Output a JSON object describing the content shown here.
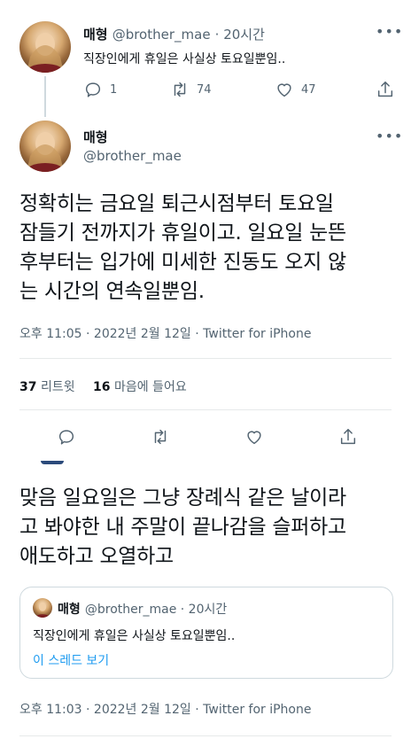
{
  "reply_tweet": {
    "name": "매형",
    "handle": "@brother_mae",
    "time": "· 20시간",
    "text": "직장인에게 휴일은 사실상 토요일뿐임..",
    "reply_count": "1",
    "retweet_count": "74",
    "like_count": "47"
  },
  "main_tweet": {
    "name": "매형",
    "handle": "@brother_mae",
    "text_lines": [
      "정확히는 금요일 퇴근시점부터 토요일",
      "잠들기 전까지가 휴일이고. 일요일 눈뜬",
      "후부터는 입가에 미세한 진동도 오지 않",
      "는 시간의 연속일뿐임."
    ],
    "meta": "오후 11:05 · 2022년 2월 12일 · Twitter for iPhone",
    "retweets_num": "37",
    "retweets_label": "리트윗",
    "likes_num": "16",
    "likes_label": "마음에 들어요"
  },
  "quote_tweet": {
    "text_lines": [
      "맞음 일요일은 그냥 장례식 같은 날이라",
      "고 봐야한 내 주말이 끝나감을 슬퍼하고",
      "애도하고 오열하고"
    ],
    "card": {
      "name": "매형",
      "handle": "@brother_mae · 20시간",
      "text": "직장인에게 휴일은 사실상 토요일뿐임..",
      "thread_link": "이 스레드 보기"
    },
    "meta": "오후 11:03 · 2022년 2월 12일 · Twitter for iPhone"
  },
  "icons": [
    "reply-icon",
    "retweet-icon",
    "like-icon",
    "share-icon",
    "more-icon"
  ],
  "colors": {
    "text": "#0f1419",
    "muted": "#536471",
    "link": "#1d9bf0",
    "divider": "#e6e9ea"
  }
}
